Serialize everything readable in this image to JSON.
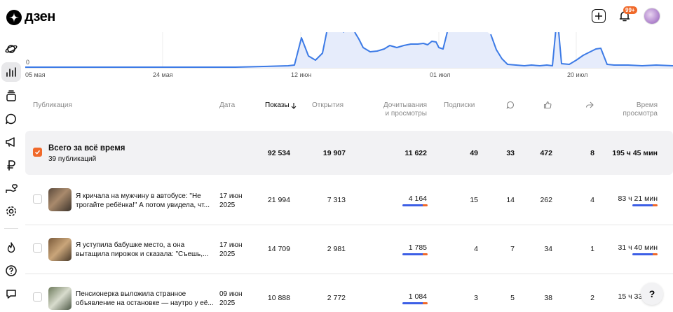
{
  "app": {
    "logo_text": "дзен",
    "notifications_badge": "99+"
  },
  "chart": {
    "zero_label": "0",
    "x_labels": [
      "05 мая",
      "24 мая",
      "12 июн",
      "01 июл",
      "20 июл"
    ],
    "line_color": "#3d7be6",
    "fill_color": "#e6ecfb"
  },
  "table": {
    "headers": {
      "publication": "Публикация",
      "date": "Дата",
      "views": "Показы",
      "opens": "Открытия",
      "reads_line1": "Дочитывания",
      "reads_line2": "и просмотры",
      "subs": "Подписки",
      "time_line1": "Время",
      "time_line2": "просмотра"
    },
    "summary": {
      "title": "Всего за всё время",
      "subtitle": "39 публикаций",
      "views": "92 534",
      "opens": "19 907",
      "reads": "11 622",
      "subs": "49",
      "comments": "33",
      "likes": "472",
      "shares": "8",
      "time": "195 ч 45 мин"
    },
    "rows": [
      {
        "title1": "Я кричала на мужчину в автобусе: \"Не",
        "title2": "трогайте ребёнка!\" А потом увидела, чт...",
        "date1": "17 июн",
        "date2": "2025",
        "views": "21 994",
        "opens": "7 313",
        "reads": "4 164",
        "subs": "15",
        "comments": "14",
        "likes": "262",
        "shares": "4",
        "time": "83 ч 21 мин"
      },
      {
        "title1": "Я уступила бабушке место, а она",
        "title2": "вытащила пирожок и сказала: \"Съешь,...",
        "date1": "17 июн",
        "date2": "2025",
        "views": "14 709",
        "opens": "2 981",
        "reads": "1 785",
        "subs": "4",
        "comments": "7",
        "likes": "34",
        "shares": "1",
        "time": "31 ч 40 мин"
      },
      {
        "title1": "Пенсионерка выложила странное",
        "title2": "объявление на остановке — наутро у её...",
        "date1": "09 июн",
        "date2": "2025",
        "views": "10 888",
        "opens": "2 772",
        "reads": "1 084",
        "subs": "3",
        "comments": "5",
        "likes": "38",
        "shares": "2",
        "time": "15 ч 33 мин"
      }
    ]
  },
  "help_label": "?",
  "colors": {
    "accent": "#f0692a",
    "bar_blue": "#3d5fe6"
  }
}
